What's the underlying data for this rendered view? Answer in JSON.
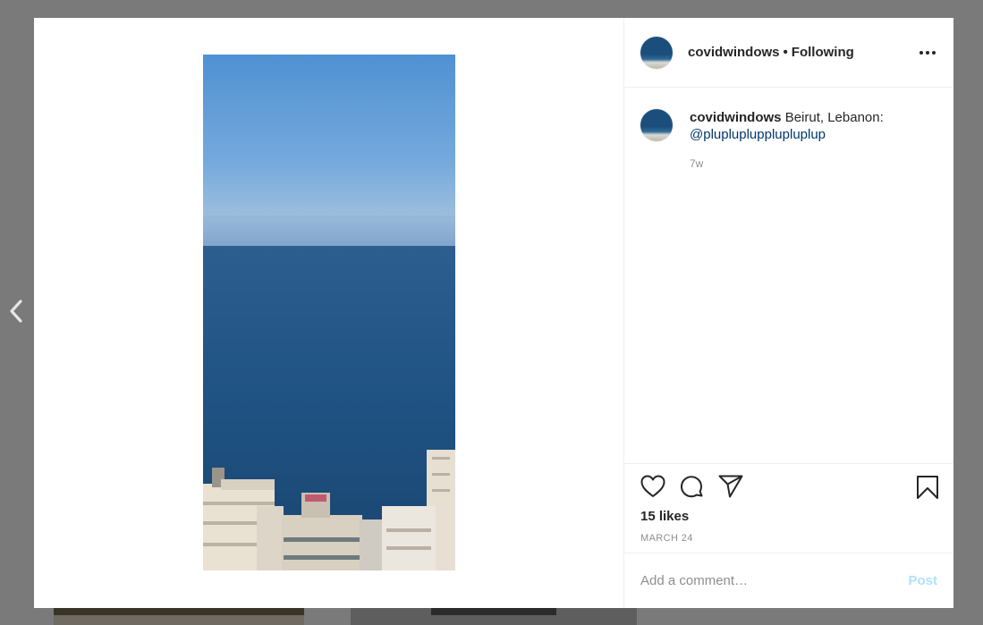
{
  "post": {
    "username": "covidwindows",
    "follow_state": "Following",
    "separator": "•",
    "caption_location": "Beirut, Lebanon:",
    "caption_mention": "@plupluplupplupluplup",
    "caption_age": "7w",
    "likes": "15 likes",
    "date": "MARCH 24"
  },
  "comment": {
    "placeholder": "Add a comment…",
    "post_label": "Post"
  },
  "icons": {
    "prev": "chevron-left-icon",
    "more": "more-options-icon",
    "like": "heart-icon",
    "comment": "comment-bubble-icon",
    "share": "paper-plane-icon",
    "save": "bookmark-icon"
  },
  "colors": {
    "link": "#00376b",
    "post_disabled": "#b2dffc",
    "sky": "#5c9bd6",
    "sea": "#1d4f7c"
  }
}
